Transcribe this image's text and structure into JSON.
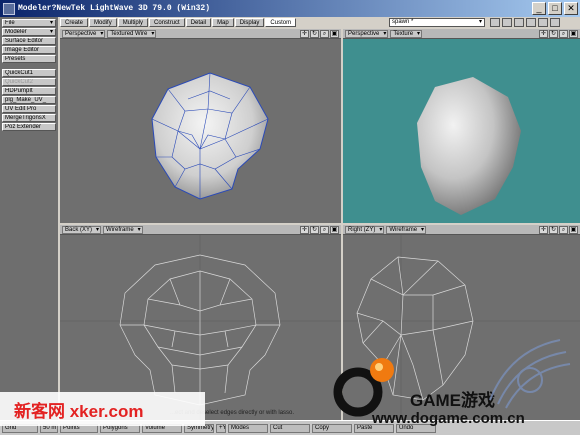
{
  "window": {
    "title": "Modeler?NewTek LightWave 3D 79.0 (Win32)",
    "buttons": [
      "_",
      "□",
      "✕"
    ]
  },
  "left_panel": {
    "items": [
      {
        "label": "File",
        "dropdown": true
      },
      {
        "label": "Modeler",
        "dropdown": true
      },
      {
        "label": "Surface Editor"
      },
      {
        "label": "Image Editor"
      },
      {
        "label": "Presets"
      },
      {
        "label": "QuickCut1"
      },
      {
        "label": "QuickCut2",
        "disabled": true
      },
      {
        "label": "HDPumpIt"
      },
      {
        "label": "plg_Make_UV_"
      },
      {
        "label": "UV Edit Pro"
      },
      {
        "label": "MergeTrigonsX"
      },
      {
        "label": "Poz Extender"
      }
    ]
  },
  "tabs": [
    {
      "label": "Create"
    },
    {
      "label": "Modify"
    },
    {
      "label": "Multiply"
    },
    {
      "label": "Construct"
    },
    {
      "label": "Detail"
    },
    {
      "label": "Map"
    },
    {
      "label": "Display"
    },
    {
      "label": "Custom",
      "active": true
    }
  ],
  "layer_select": {
    "value": "spawn *"
  },
  "viewports": [
    {
      "view": "Perspective",
      "mode": "Textured Wire"
    },
    {
      "view": "Perspective",
      "mode": "Texture"
    },
    {
      "view": "Back",
      "axes": "(XY)",
      "mode": "Wireframe"
    },
    {
      "view": "Right",
      "axes": "(ZY)",
      "mode": "Wireframe"
    }
  ],
  "viewport_icons": [
    "move-view-icon",
    "rotate-view-icon",
    "zoom-view-icon",
    "maximize-view-icon"
  ],
  "status": {
    "message": "...ect and deselect edges directly or with lasso.",
    "grid_label": "Grid",
    "grid_value": "50 m",
    "points": "Points",
    "polygons": "Polygons",
    "volume": "Volume",
    "symmetry": "Symmetry",
    "axis": "+Y",
    "modes": "Modes",
    "cut": "Cut",
    "copy": "Copy",
    "paste": "Paste",
    "undo": "Undo"
  },
  "watermarks": {
    "left": "新客网 xker.com",
    "right_brand": "GAME游戏",
    "right_url": "www.dogame.com.cn"
  },
  "colors": {
    "viewport_gray": "#6f6f6f",
    "texture_bg": "#3f8f8f",
    "wire_blue": "#2a4ab8"
  }
}
